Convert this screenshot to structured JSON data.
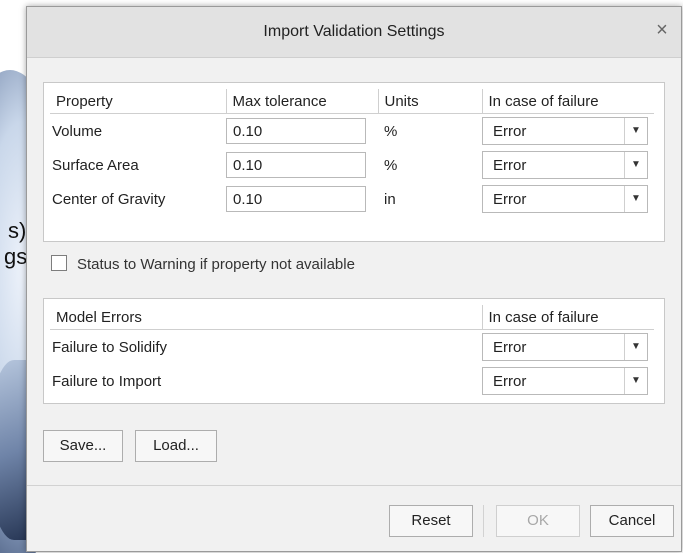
{
  "background": {
    "text_line1": "s)",
    "text_line2": "gs"
  },
  "dialog": {
    "title": "Import Validation Settings",
    "close_glyph": "×"
  },
  "properties_table": {
    "headers": [
      "Property",
      "Max tolerance",
      "Units",
      "In case of failure"
    ],
    "rows": [
      {
        "property": "Volume",
        "tolerance": "0.10",
        "units": "%",
        "failure": "Error"
      },
      {
        "property": "Surface Area",
        "tolerance": "0.10",
        "units": "%",
        "failure": "Error"
      },
      {
        "property": "Center of Gravity",
        "tolerance": "0.10",
        "units": "in",
        "failure": "Error"
      }
    ]
  },
  "status_checkbox": {
    "label": "Status to Warning if property not available",
    "checked": false
  },
  "errors_table": {
    "headers": [
      "Model Errors",
      "In case of failure"
    ],
    "rows": [
      {
        "error": "Failure to Solidify",
        "failure": "Error"
      },
      {
        "error": "Failure to Import",
        "failure": "Error"
      }
    ]
  },
  "buttons": {
    "save": "Save...",
    "load": "Load...",
    "reset": "Reset",
    "ok": "OK",
    "cancel": "Cancel"
  },
  "colors": {
    "dialog_bg": "#f1f1f1",
    "titlebar_bg": "#e2e2e2",
    "panel_bg": "#ffffff",
    "disabled_text": "#a8a8a8"
  },
  "icons": {
    "dropdown": "chevron-down-icon",
    "close": "close-icon"
  }
}
